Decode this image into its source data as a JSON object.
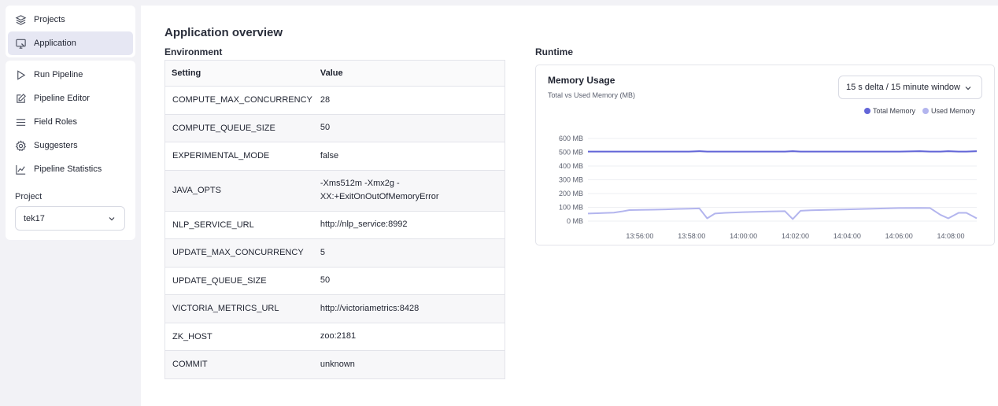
{
  "sidebar": {
    "nav_top": [
      {
        "label": "Projects",
        "icon": "layers-icon"
      },
      {
        "label": "Application",
        "icon": "monitor-icon",
        "active": true
      }
    ],
    "nav_main": [
      {
        "label": "Run Pipeline",
        "icon": "play-icon"
      },
      {
        "label": "Pipeline Editor",
        "icon": "edit-icon"
      },
      {
        "label": "Field Roles",
        "icon": "menu-icon"
      },
      {
        "label": "Suggesters",
        "icon": "gear-icon"
      },
      {
        "label": "Pipeline Statistics",
        "icon": "line-chart-icon"
      }
    ],
    "project_label": "Project",
    "project_value": "tek17"
  },
  "page": {
    "title": "Application overview",
    "environment_title": "Environment",
    "runtime_title": "Runtime"
  },
  "environment": {
    "headers": [
      "Setting",
      "Value"
    ],
    "rows": [
      {
        "setting": "COMPUTE_MAX_CONCURRENCY",
        "value": "28"
      },
      {
        "setting": "COMPUTE_QUEUE_SIZE",
        "value": "50"
      },
      {
        "setting": "EXPERIMENTAL_MODE",
        "value": "false"
      },
      {
        "setting": "JAVA_OPTS",
        "value": "-Xms512m -Xmx2g -",
        "value2": "XX:+ExitOnOutOfMemoryError"
      },
      {
        "setting": "NLP_SERVICE_URL",
        "value": "http://nlp_service:8992"
      },
      {
        "setting": "UPDATE_MAX_CONCURRENCY",
        "value": "5"
      },
      {
        "setting": "UPDATE_QUEUE_SIZE",
        "value": "50"
      },
      {
        "setting": "VICTORIA_METRICS_URL",
        "value": "http://victoriametrics:8428"
      },
      {
        "setting": "ZK_HOST",
        "value": "zoo:2181"
      },
      {
        "setting": "COMMIT",
        "value": "unknown"
      }
    ]
  },
  "runtime": {
    "card_title": "Memory Usage",
    "card_subtitle": "Total vs Used Memory (MB)",
    "range_value": "15 s delta / 15 minute window"
  },
  "colors": {
    "total": "#6366d8",
    "used": "#b3b5ee",
    "active_nav": "#e6e7f3"
  },
  "chart_data": {
    "type": "line",
    "title": "Memory Usage",
    "subtitle": "Total vs Used Memory (MB)",
    "y_ticks": [
      "600 MB",
      "500 MB",
      "400 MB",
      "300 MB",
      "200 MB",
      "100 MB",
      "0 MB"
    ],
    "y_tick_values": [
      600,
      500,
      400,
      300,
      200,
      100,
      0
    ],
    "x_ticks": [
      "13:56:00",
      "13:58:00",
      "14:00:00",
      "14:02:00",
      "14:04:00",
      "14:06:00",
      "14:08:00"
    ],
    "x_tick_minutes": [
      2,
      4,
      6,
      8,
      10,
      12,
      14
    ],
    "ylim": [
      0,
      600
    ],
    "xlim_minutes": [
      0,
      15
    ],
    "grid": true,
    "legend_position": "top-right",
    "x_minutes": [
      0,
      1,
      1.3,
      1.6,
      2,
      2.5,
      3,
      3.4,
      3.9,
      4.3,
      4.6,
      4.9,
      5.3,
      6,
      7,
      7.6,
      7.9,
      8.2,
      8.6,
      9.2,
      10,
      11,
      12,
      12.8,
      13.2,
      13.6,
      13.9,
      14.3,
      14.6,
      15
    ],
    "series": [
      {
        "name": "Total Memory",
        "values": [
          505,
          505,
          505,
          505,
          505,
          505,
          505,
          505,
          505,
          508,
          505,
          505,
          505,
          505,
          505,
          505,
          508,
          505,
          505,
          505,
          505,
          505,
          505,
          508,
          505,
          505,
          508,
          505,
          505,
          508
        ]
      },
      {
        "name": "Used Memory",
        "values": [
          55,
          62,
          70,
          80,
          82,
          83,
          85,
          88,
          90,
          92,
          20,
          55,
          60,
          65,
          70,
          72,
          15,
          75,
          78,
          82,
          85,
          90,
          95,
          96,
          95,
          45,
          20,
          60,
          60,
          20
        ]
      }
    ]
  }
}
